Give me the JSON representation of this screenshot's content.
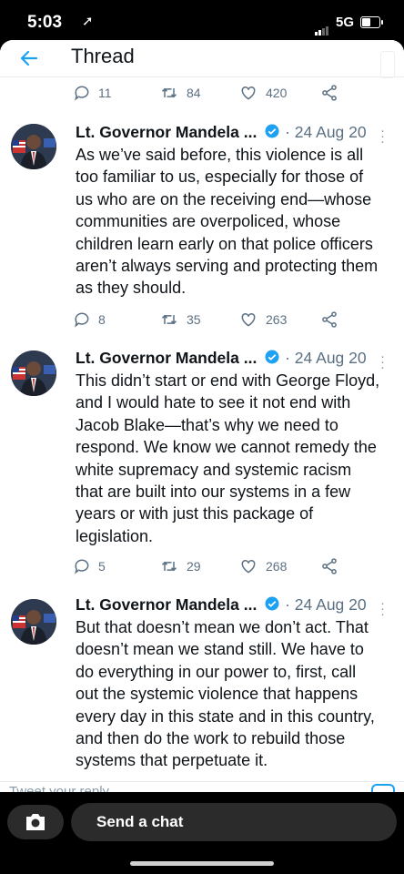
{
  "status_bar": {
    "time": "5:03",
    "network": "5G"
  },
  "header": {
    "title": "Thread"
  },
  "top_stats": {
    "replies": "11",
    "retweets": "84",
    "likes": "420"
  },
  "tweets": [
    {
      "author": "Lt. Governor Mandela ...",
      "date": "· 24 Aug 20",
      "text": "As we’ve said before, this violence is all\ntoo familiar to us, especially for those of\nus who are on the receiving end—whose\ncommunities are overpoliced, whose\nchildren learn early on that police officers\naren’t always serving and protecting them\nas they should.",
      "replies": "8",
      "retweets": "35",
      "likes": "263"
    },
    {
      "author": "Lt. Governor Mandela ...",
      "date": "· 24 Aug 20",
      "text": "This didn’t start or end with George Floyd,\nand I would hate to see it not end with\nJacob Blake—that’s why we need to\nrespond. We know we cannot remedy the\nwhite supremacy and systemic racism\nthat are built into our systems in a few\nyears or with just this package of\nlegislation.",
      "replies": "5",
      "retweets": "29",
      "likes": "268"
    },
    {
      "author": "Lt. Governor Mandela ...",
      "date": "· 24 Aug 20",
      "text": "But that doesn’t mean we don’t act. That\ndoesn’t mean we stand still. We have to\ndo everything in our power to, first, call\nout the systemic violence that happens\nevery day in this state and in this country,\nand then do the work to rebuild those\nsystems that perpetuate it."
    }
  ],
  "reply_bar": {
    "placeholder": "Tweet your reply"
  },
  "chat_bar": {
    "label": "Send a chat"
  },
  "colors": {
    "accent": "#1da1f2",
    "muted": "#5b7083",
    "verified": "#1da1f2"
  }
}
